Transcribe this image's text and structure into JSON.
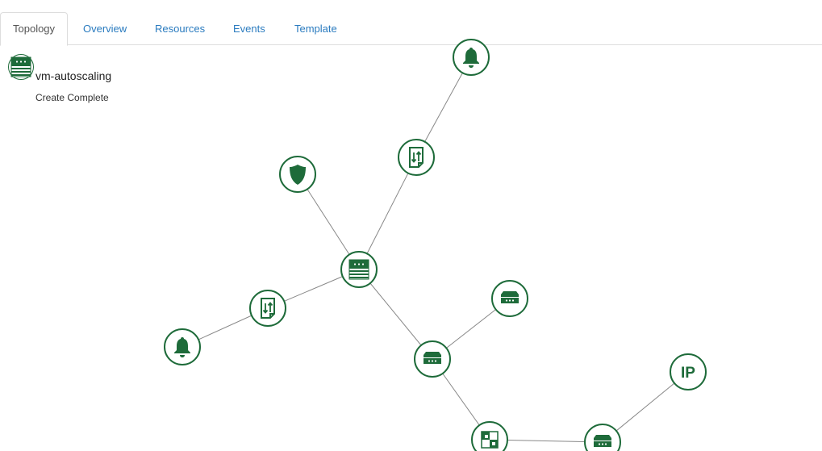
{
  "tabs": [
    {
      "label": "Topology",
      "active": true
    },
    {
      "label": "Overview",
      "active": false
    },
    {
      "label": "Resources",
      "active": false
    },
    {
      "label": "Events",
      "active": false
    },
    {
      "label": "Template",
      "active": false
    }
  ],
  "stack": {
    "name": "vm-autoscaling",
    "status": "Create Complete",
    "icon": "server-icon"
  },
  "colors": {
    "node_green": "#1e6b3a",
    "link_gray": "#888888",
    "tab_link": "#2a7bbf"
  },
  "topology": {
    "nodes": [
      {
        "id": "alarm-top",
        "icon": "bell-icon"
      },
      {
        "id": "policy-top",
        "icon": "scaling-policy-icon"
      },
      {
        "id": "security-group",
        "icon": "shield-icon"
      },
      {
        "id": "autoscaling-group",
        "icon": "server-icon"
      },
      {
        "id": "policy-left",
        "icon": "scaling-policy-icon"
      },
      {
        "id": "alarm-left",
        "icon": "bell-icon"
      },
      {
        "id": "router-right",
        "icon": "router-icon"
      },
      {
        "id": "router-center",
        "icon": "router-icon"
      },
      {
        "id": "floating-ip",
        "icon": "ip-icon",
        "text": "IP"
      },
      {
        "id": "network",
        "icon": "network-icon"
      },
      {
        "id": "router-bottom",
        "icon": "router-icon"
      }
    ],
    "links": [
      [
        "alarm-top",
        "policy-top"
      ],
      [
        "policy-top",
        "autoscaling-group"
      ],
      [
        "security-group",
        "autoscaling-group"
      ],
      [
        "autoscaling-group",
        "policy-left"
      ],
      [
        "policy-left",
        "alarm-left"
      ],
      [
        "autoscaling-group",
        "router-center"
      ],
      [
        "router-center",
        "router-right"
      ],
      [
        "router-center",
        "network"
      ],
      [
        "network",
        "router-bottom"
      ],
      [
        "router-bottom",
        "floating-ip"
      ]
    ]
  }
}
